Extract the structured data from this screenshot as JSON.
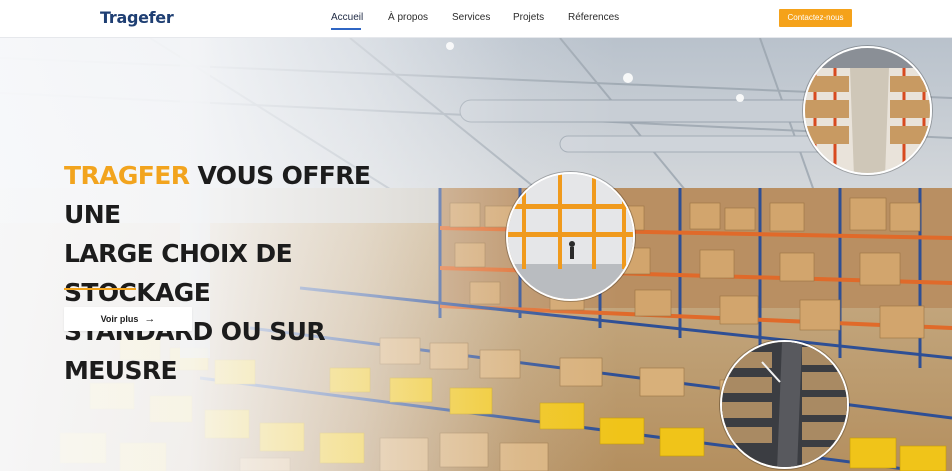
{
  "header": {
    "logo": "Tragefer",
    "nav": [
      {
        "label": "Accueil",
        "active": true
      },
      {
        "label": "À propos",
        "active": false
      },
      {
        "label": "Services",
        "active": false
      },
      {
        "label": "Projets",
        "active": false
      },
      {
        "label": "Réferences",
        "active": false
      }
    ],
    "cta_label": "Contactez-nous"
  },
  "hero": {
    "headline_brand": "TRAGFER",
    "headline_line1_rest": " VOUS OFFRE UNE",
    "headline_line2": "LARGE CHOIX DE STOCKAGE",
    "headline_line3": "STANDARD OU SUR MEUSRE",
    "button_label": "Voir plus",
    "button_icon": "arrow-right-icon"
  },
  "colors": {
    "brand_navy": "#1f3f73",
    "accent_orange": "#f5a21a",
    "nav_active_underline": "#2f66c4"
  }
}
